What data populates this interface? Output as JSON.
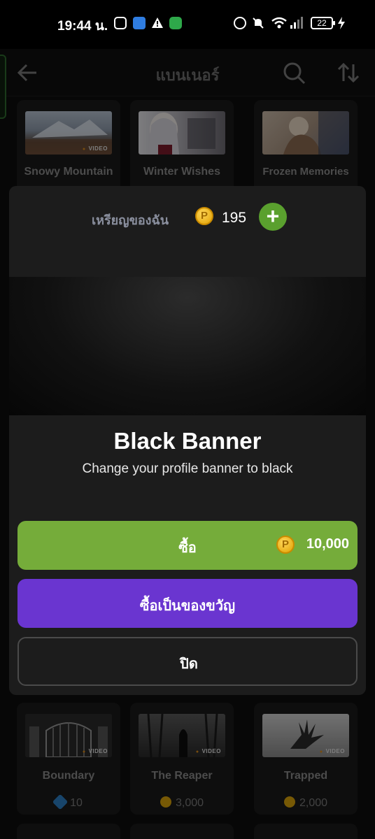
{
  "status_bar": {
    "time": "19:44 น.",
    "battery": "22",
    "icons": [
      "instagram-icon",
      "app-icon",
      "warning-icon",
      "shield-icon",
      "alarm-icon",
      "mute-icon",
      "wifi-icon",
      "signal-icon",
      "charging-icon"
    ]
  },
  "header": {
    "title": "แบนเนอร์",
    "back_icon": "back-arrow-icon",
    "search_icon": "search-icon",
    "sort_icon": "sort-icon"
  },
  "top_cards": [
    {
      "title": "Snowy Mountain",
      "video": "VIDEO"
    },
    {
      "title": "Winter Wishes"
    },
    {
      "title": "Frozen Memories"
    }
  ],
  "bottom_cards": [
    {
      "title": "Boundary",
      "video": "VIDEO",
      "price": "10",
      "currency": "gem"
    },
    {
      "title": "The Reaper",
      "video": "VIDEO",
      "price": "3,000",
      "currency": "coin"
    },
    {
      "title": "Trapped",
      "video": "VIDEO",
      "price": "2,000",
      "currency": "coin"
    }
  ],
  "sheet": {
    "coins_label": "เหรียญของฉัน",
    "coin_symbol": "P",
    "coins_value": "195",
    "add_symbol": "+",
    "item_title": "Black Banner",
    "item_description": "Change your profile banner to black",
    "buy_label": "ซื้อ",
    "buy_price": "10,000",
    "gift_label": "ซื้อเป็นของขวัญ",
    "close_label": "ปิด"
  },
  "colors": {
    "buy": "#75ac3a",
    "gift": "#6a35d0",
    "plus": "#5aa02e",
    "coin": "#f2b705"
  }
}
